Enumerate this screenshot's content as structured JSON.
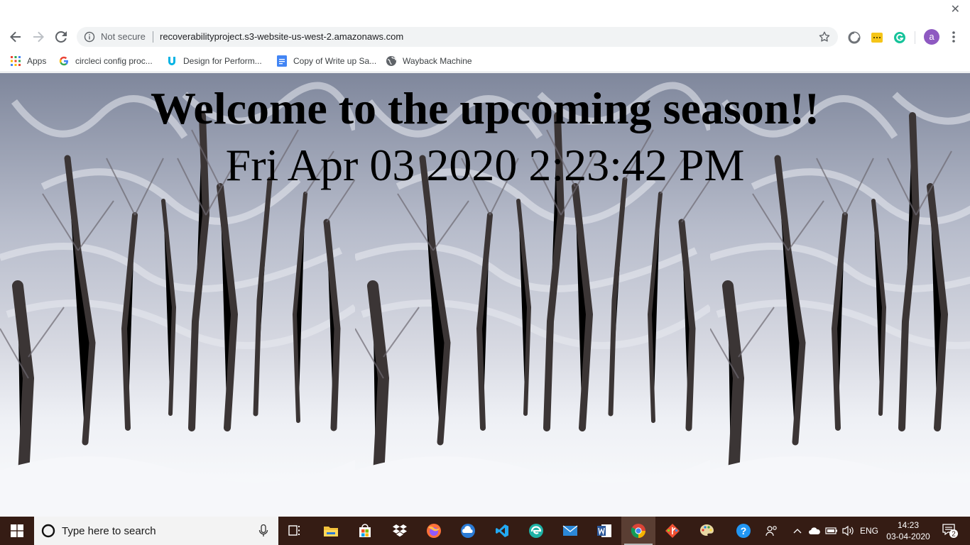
{
  "browser": {
    "omnibox": {
      "security_label": "Not secure",
      "url": "recoverabilityproject.s3-website-us-west-2.amazonaws.com"
    },
    "bookmarks": [
      {
        "label": "Apps",
        "icon": "apps-grid-icon"
      },
      {
        "label": "circleci config proc...",
        "icon": "google-icon"
      },
      {
        "label": "Design for Perform...",
        "icon": "udacity-icon"
      },
      {
        "label": "Copy of Write up Sa...",
        "icon": "google-docs-icon"
      },
      {
        "label": "Wayback Machine",
        "icon": "globe-icon"
      }
    ],
    "profile_initial": "a"
  },
  "page": {
    "title": "Welcome to the upcoming season!!",
    "datetime": "Fri Apr 03 2020 2:23:42 PM"
  },
  "taskbar": {
    "search_placeholder": "Type here to search",
    "language": "ENG",
    "time": "14:23",
    "date": "03-04-2020",
    "notification_count": "2"
  },
  "colors": {
    "taskbar_bg": "#351c14",
    "avatar": "#8e59c1",
    "omnibox_bg": "#f1f3f4"
  }
}
